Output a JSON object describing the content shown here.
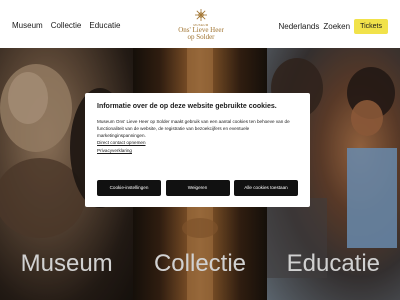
{
  "header": {
    "nav_left": [
      "Museum",
      "Collectie",
      "Educatie"
    ],
    "logo": {
      "small": "MUSEUM",
      "line1": "Ons' Lieve Heer",
      "line2": "op Solder"
    },
    "language": "Nederlands",
    "search": "Zoeken",
    "tickets": "Tickets"
  },
  "hero": {
    "panels": [
      {
        "label": "Museum"
      },
      {
        "label": "Collectie"
      },
      {
        "label": "Educatie"
      }
    ]
  },
  "cookie_dialog": {
    "title": "Informatie over de op deze website gebruikte cookies.",
    "body": "Museum Ons' Lieve Heer op Solder maakt gebruik van een aantal cookies ten behoeve van de functionaliteit van de website, de registratie van bezoekcijfers en eventuele marketinginspanningen.",
    "link_contact": "Direct contact opnemen",
    "link_privacy": "Privacyverklaring",
    "buttons": {
      "settings": "Cookie-instellingen",
      "reject": "Weigeren",
      "accept": "Alle cookies toestaan"
    }
  },
  "colors": {
    "accent_gold": "#a0732f",
    "tickets_yellow": "#f1e24a",
    "button_dark": "#111111"
  }
}
